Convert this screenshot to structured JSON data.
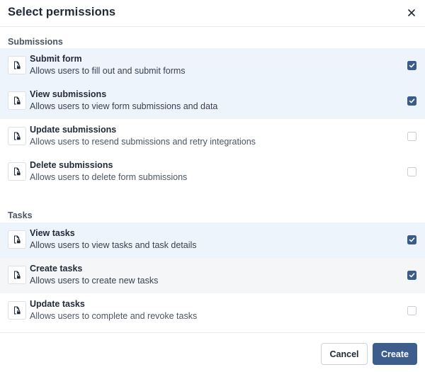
{
  "dialog": {
    "title": "Select permissions",
    "close_icon": "close-icon"
  },
  "sections": [
    {
      "title": "Submissions",
      "items": [
        {
          "name": "Submit form",
          "description": "Allows users to fill out and submit forms",
          "checked": true,
          "icon": "file-lock-icon"
        },
        {
          "name": "View submissions",
          "description": "Allows users to view form submissions and data",
          "checked": true,
          "icon": "file-lock-icon"
        },
        {
          "name": "Update submissions",
          "description": "Allows users to resend submissions and retry integrations",
          "checked": false,
          "icon": "file-lock-icon"
        },
        {
          "name": "Delete submissions",
          "description": "Allows users to delete form submissions",
          "checked": false,
          "icon": "file-lock-icon"
        }
      ]
    },
    {
      "title": "Tasks",
      "items": [
        {
          "name": "View tasks",
          "description": "Allows users to view tasks and task details",
          "checked": true,
          "icon": "file-lock-icon"
        },
        {
          "name": "Create tasks",
          "description": "Allows users to create new tasks",
          "checked": true,
          "icon": "file-lock-icon"
        },
        {
          "name": "Update tasks",
          "description": "Allows users to complete and revoke tasks",
          "checked": false,
          "icon": "file-lock-icon"
        }
      ]
    }
  ],
  "footer": {
    "cancel_label": "Cancel",
    "create_label": "Create"
  },
  "colors": {
    "accent": "#3d5d8d",
    "checked_row": "#eef4fc",
    "hover_row": "#f5f6f7",
    "border": "#e6e8ec"
  }
}
